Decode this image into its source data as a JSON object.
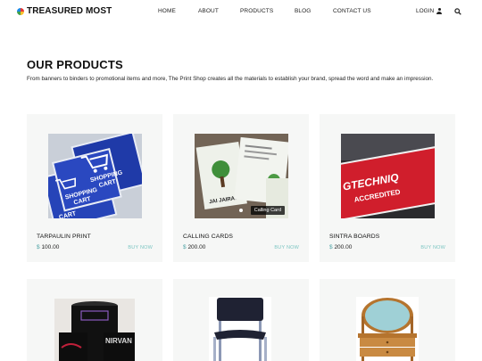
{
  "header": {
    "logo_text": "TREASURED MOST",
    "nav": [
      "HOME",
      "ABOUT",
      "PRODUCTS",
      "BLOG",
      "CONTACT US"
    ],
    "login_label": "LOGIN"
  },
  "section": {
    "title": "OUR PRODUCTS",
    "description": "From banners to binders to promotional items and more, The Print Shop creates all the materials to establish your brand, spread the word and make an impression."
  },
  "products": [
    {
      "name": "TARPAULIN PRINT",
      "currency": "$",
      "price": "100.00",
      "buy_label": "BUY NOW",
      "image_text": [
        "SHOPPING",
        "CART",
        "SHOPPING",
        "CART",
        "CART"
      ]
    },
    {
      "name": "CALLING CARDS",
      "currency": "$",
      "price": "200.00",
      "buy_label": "BUY NOW",
      "image_caption": "Calling Card"
    },
    {
      "name": "SINTRA BOARDS",
      "currency": "$",
      "price": "200.00",
      "buy_label": "BUY NOW",
      "image_text": [
        "GTECHNIQ",
        "ACCREDITED"
      ]
    },
    {
      "name": "",
      "image": "mugs"
    },
    {
      "name": "",
      "image": "chair"
    },
    {
      "name": "",
      "image": "vanity-mirror"
    }
  ],
  "colors": {
    "accent": "#7cc5c2",
    "card_bg": "#f6f7f6",
    "price_symbol": "#4fa3a5"
  }
}
